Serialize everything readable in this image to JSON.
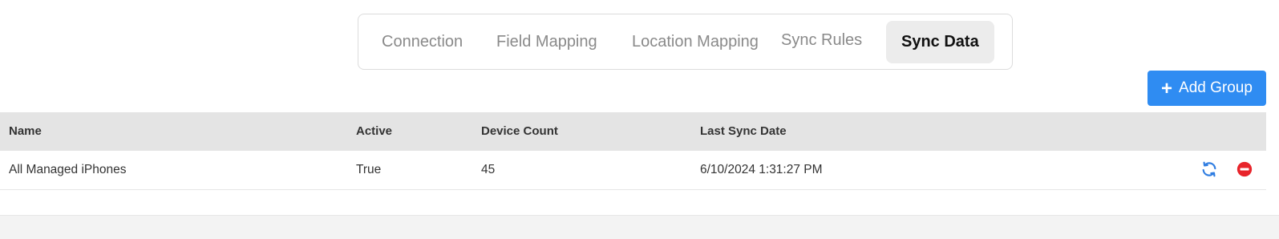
{
  "tabs": [
    {
      "label": "Connection"
    },
    {
      "label": "Field Mapping"
    },
    {
      "label": "Location Mapping"
    },
    {
      "label": "Sync Rules"
    },
    {
      "label": "Sync Data",
      "active": true
    }
  ],
  "toolbar": {
    "add_group_icon": "+",
    "add_group_label": "Add Group"
  },
  "table": {
    "columns": [
      "Name",
      "Active",
      "Device Count",
      "Last Sync Date"
    ],
    "rows": [
      {
        "name": "All Managed iPhones",
        "active": "True",
        "device_count": "45",
        "last_sync_date": "6/10/2024 1:31:27 PM",
        "actions": [
          "sync-icon",
          "remove-icon"
        ]
      }
    ]
  },
  "colors": {
    "accent": "#2f8cf2",
    "danger": "#e8242b",
    "header_bg": "#e4e4e4"
  }
}
